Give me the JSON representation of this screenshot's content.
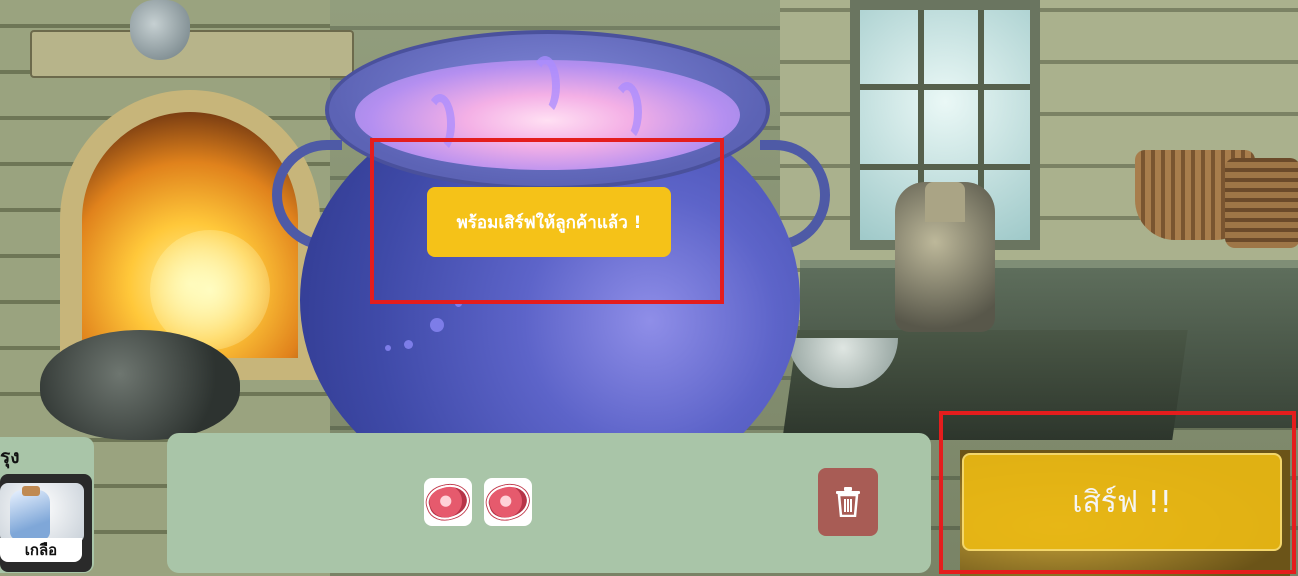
{
  "status": {
    "ready_message": "พร้อมเสิร์ฟให้ลูกค้าแล้ว !"
  },
  "side_panel": {
    "title_fragment": "รุง",
    "selected_item": {
      "label": "เกลือ",
      "icon": "salt-bottle-icon"
    }
  },
  "tray": {
    "ingredients": [
      {
        "icon": "meat-icon"
      },
      {
        "icon": "meat-icon"
      }
    ],
    "discard_icon": "trash-icon"
  },
  "actions": {
    "serve_label": "เสิร์ฟ !!"
  },
  "colors": {
    "ready_badge": "#f5c218",
    "serve_button": "#e9b813",
    "tray": "#a9c5a8",
    "trash_button": "#a85c55",
    "highlight_box": "#e41d1d"
  }
}
